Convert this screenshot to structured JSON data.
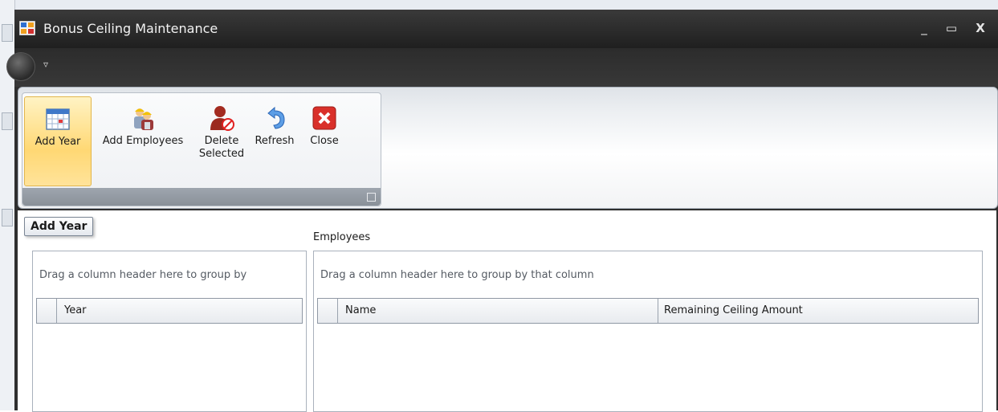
{
  "window": {
    "title": "Bonus Ceiling Maintenance",
    "controls": {
      "minimize": "_",
      "maximize": "▭",
      "close": "X"
    }
  },
  "qat": {
    "dropdown_glyph": "▿"
  },
  "ribbon": {
    "buttons": [
      {
        "label": "Add Year",
        "icon": "calendar-icon",
        "active": true
      },
      {
        "label": "Add Employees",
        "icon": "workers-icon",
        "active": false
      },
      {
        "label": "Delete\nSelected",
        "icon": "delete-person-icon",
        "active": false
      },
      {
        "label": "Refresh",
        "icon": "refresh-icon",
        "active": false
      },
      {
        "label": "Close",
        "icon": "close-red-icon",
        "active": false
      }
    ]
  },
  "tooltip": {
    "text": "Add Year"
  },
  "year_panel": {
    "group_hint": "Drag a column header here to group by",
    "columns": [
      "Year"
    ]
  },
  "employees_panel": {
    "label": "Employees",
    "group_hint": "Drag a column header here to group by that column",
    "columns": [
      "Name",
      "Remaining Ceiling Amount"
    ]
  },
  "colors": {
    "active_button": "#ffd874",
    "titlebar": "#2b2b2b",
    "close_icon": "#d9302a"
  }
}
